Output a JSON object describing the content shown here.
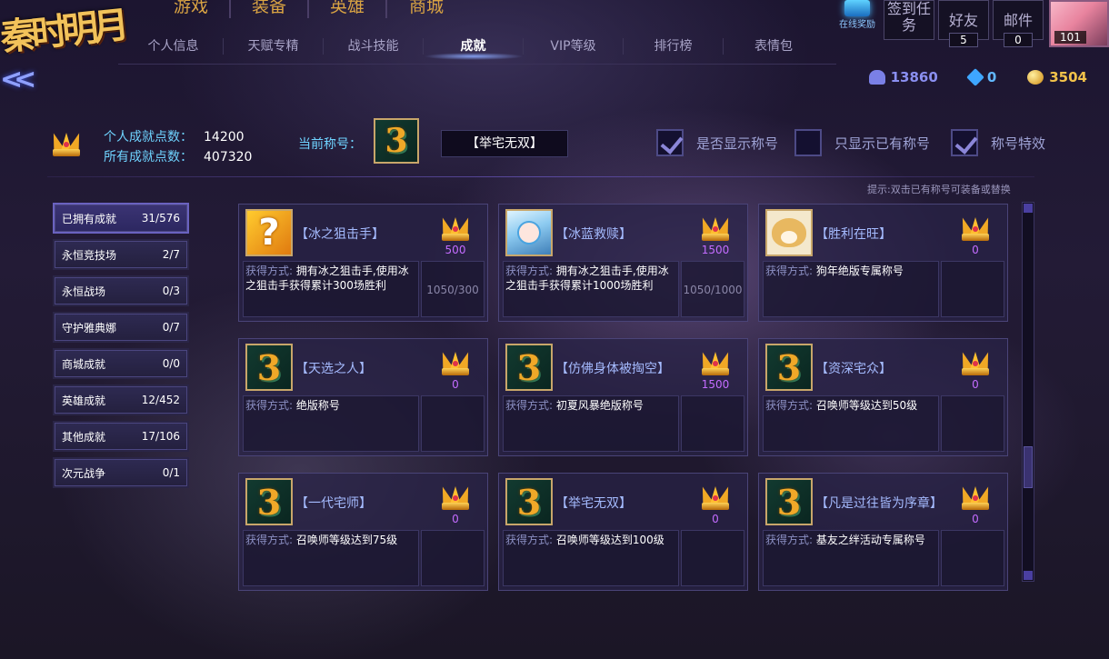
{
  "logo": "秦时明月",
  "main_nav": [
    "游戏",
    "装备",
    "英雄",
    "商城"
  ],
  "sub_tabs": [
    "个人信息",
    "天赋专精",
    "战斗技能",
    "成就",
    "VIP等级",
    "排行榜",
    "表情包"
  ],
  "active_tab": "成就",
  "online_reward": "在线奖励",
  "top_buttons": {
    "sign": "签到任务",
    "friends": "好友",
    "friends_count": "5",
    "mail": "邮件",
    "mail_count": "0"
  },
  "player_level": "101",
  "resources": {
    "friends": "13860",
    "gems": "0",
    "gold": "3504"
  },
  "achievement_points": {
    "personal_label": "个人成就点数：",
    "personal_value": "14200",
    "total_label": "所有成就点数：",
    "total_value": "407320"
  },
  "current_title": {
    "label": "当前称号：",
    "value": "【举宅无双】"
  },
  "options": [
    {
      "label": "是否显示称号",
      "checked": true
    },
    {
      "label": "只显示已有称号",
      "checked": false
    },
    {
      "label": "称号特效",
      "checked": true
    }
  ],
  "hint": "提示:双击已有称号可装备或替换",
  "categories": [
    {
      "label": "已拥有成就",
      "count": "31/576"
    },
    {
      "label": "永恒竞技场",
      "count": "2/7"
    },
    {
      "label": "永恒战场",
      "count": "0/3"
    },
    {
      "label": "守护雅典娜",
      "count": "0/7"
    },
    {
      "label": "商城成就",
      "count": "0/0"
    },
    {
      "label": "英雄成就",
      "count": "12/452"
    },
    {
      "label": "其他成就",
      "count": "17/106"
    },
    {
      "label": "次元战争",
      "count": "0/1"
    }
  ],
  "acquire_label": "获得方式:",
  "achievements": [
    {
      "name": "【冰之狙击手】",
      "icon": "question-mark-icon",
      "reward": "500",
      "desc": "拥有冰之狙击手,使用冰之狙击手获得累计300场胜利",
      "progress": "1050/300"
    },
    {
      "name": "【冰蓝救赎】",
      "icon": "blue-hair-girl-icon",
      "reward": "1500",
      "desc": "拥有冰之狙击手,使用冰之狙击手获得累计1000场胜利",
      "progress": "1050/1000"
    },
    {
      "name": "【胜利在旺】",
      "icon": "shiba-dog-icon",
      "reward": "0",
      "desc": "狗年绝版专属称号",
      "progress": ""
    },
    {
      "name": "【天选之人】",
      "icon": "title-badge-icon",
      "reward": "0",
      "desc": "绝版称号",
      "progress": ""
    },
    {
      "name": "【仿佛身体被掏空】",
      "icon": "title-badge-icon",
      "reward": "1500",
      "desc": "初夏风暴绝版称号",
      "progress": ""
    },
    {
      "name": "【资深宅众】",
      "icon": "title-badge-icon",
      "reward": "0",
      "desc": "召唤师等级达到50级",
      "progress": ""
    },
    {
      "name": "【一代宅师】",
      "icon": "title-badge-icon",
      "reward": "0",
      "desc": "召唤师等级达到75级",
      "progress": ""
    },
    {
      "name": "【举宅无双】",
      "icon": "title-badge-icon",
      "reward": "0",
      "desc": "召唤师等级达到100级",
      "progress": ""
    },
    {
      "name": "【凡是过往皆为序章】",
      "icon": "title-badge-icon",
      "reward": "0",
      "desc": "基友之绊活动专属称号",
      "progress": ""
    }
  ],
  "colors": {
    "accent": "#6fd3ff",
    "reward_num": "#c46cff",
    "nav_gold": "#d9a343",
    "name_blue": "#a5bbff"
  }
}
